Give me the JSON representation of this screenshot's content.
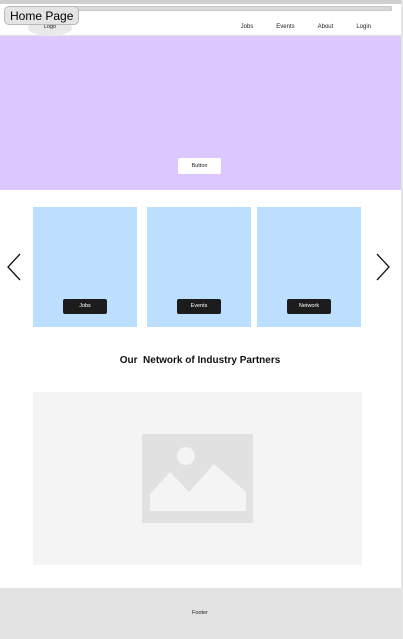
{
  "window": {
    "page_label": "Home Page"
  },
  "header": {
    "logo": "Logo",
    "nav": [
      {
        "label": "Jobs"
      },
      {
        "label": "Events"
      },
      {
        "label": "About"
      },
      {
        "label": "Login"
      }
    ]
  },
  "hero": {
    "button_label": "Button",
    "background": "#dcc7ff"
  },
  "carousel": {
    "prev_icon": "chevron-left-icon",
    "next_icon": "chevron-right-icon",
    "card_color": "#bddfff",
    "cards": [
      {
        "button_label": "Jobs"
      },
      {
        "button_label": "Events"
      },
      {
        "button_label": "Network"
      }
    ]
  },
  "partners": {
    "title": "Our  Network of Industry Partners",
    "image_icon": "image-placeholder-icon"
  },
  "footer": {
    "label": "Footer"
  }
}
